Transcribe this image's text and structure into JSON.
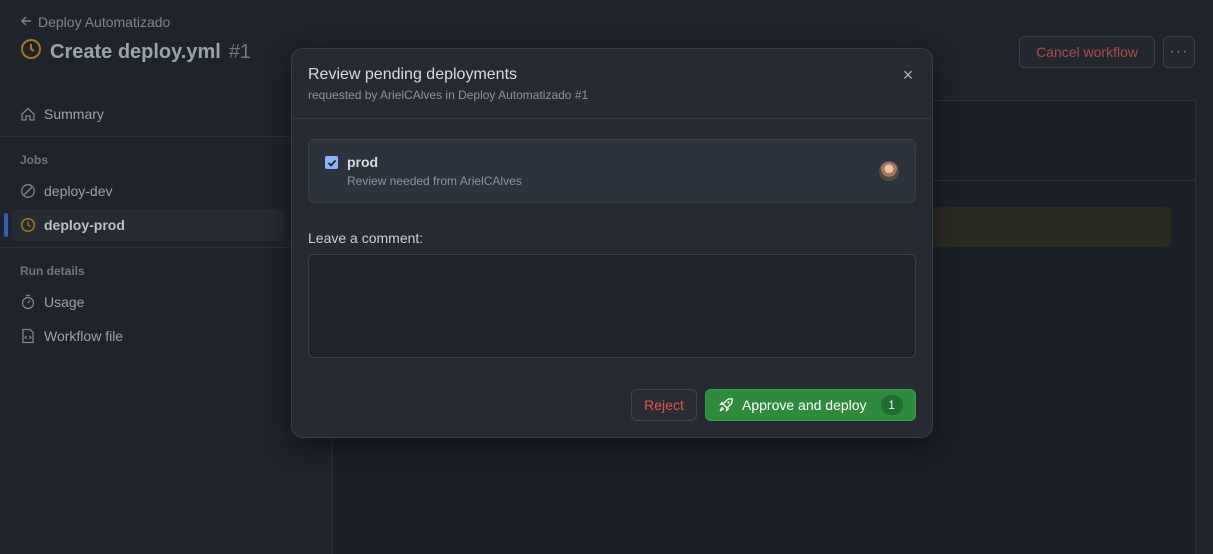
{
  "breadcrumb": {
    "back_label": "Deploy Automatizado"
  },
  "run": {
    "title": "Create deploy.yml",
    "number": "#1"
  },
  "actions": {
    "cancel_label": "Cancel workflow",
    "more_label": "···"
  },
  "sidebar": {
    "summary_label": "Summary",
    "jobs_heading": "Jobs",
    "jobs": [
      {
        "label": "deploy-dev"
      },
      {
        "label": "deploy-prod"
      }
    ],
    "run_details_heading": "Run details",
    "details": [
      {
        "label": "Usage"
      },
      {
        "label": "Workflow file"
      }
    ]
  },
  "modal": {
    "title": "Review pending deployments",
    "subtitle": "requested by ArielCAlves in Deploy Automatizado #1",
    "close_label": "×",
    "environment": {
      "name": "prod",
      "description": "Review needed from ArielCAlves",
      "checked": true
    },
    "comment_label": "Leave a comment:",
    "comment_value": "",
    "reject_label": "Reject",
    "approve_label": "Approve and deploy",
    "approve_count": "1"
  },
  "colors": {
    "accent_blue": "#2f5fae",
    "approve_green": "#2e8b3e",
    "reject_red": "#e5534b",
    "pending_orange": "#c58a1a"
  }
}
